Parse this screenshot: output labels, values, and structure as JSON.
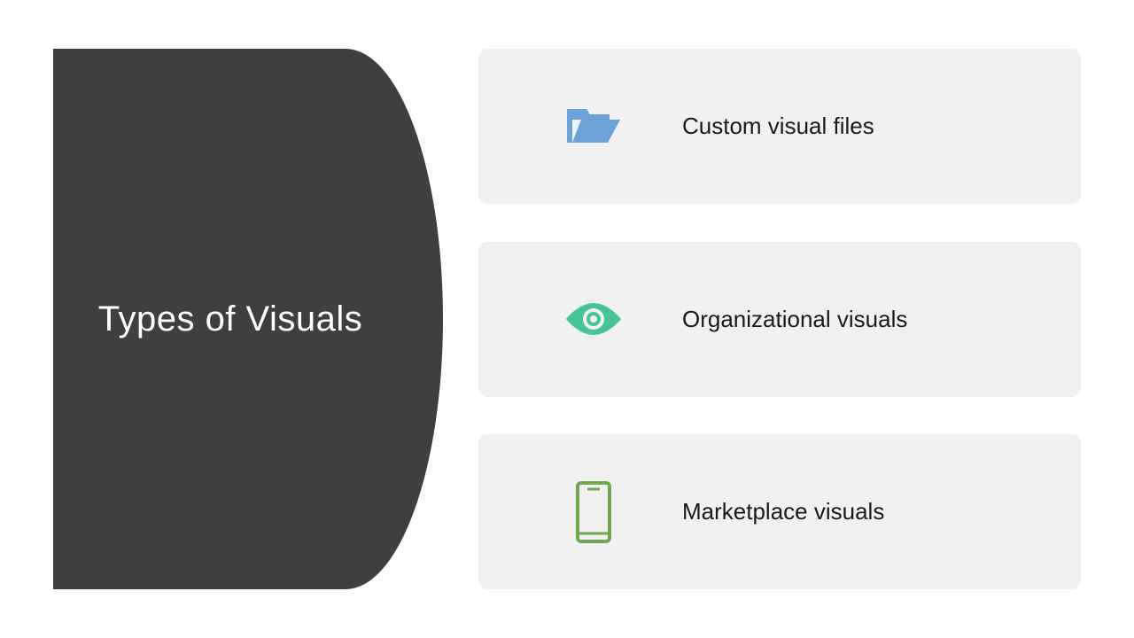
{
  "sidebar": {
    "title": "Types of Visuals"
  },
  "cards": [
    {
      "icon": "folder-open-icon",
      "color": "#6ba3d9",
      "label": "Custom visual files"
    },
    {
      "icon": "eye-icon",
      "color": "#47c494",
      "label": "Organizational visuals"
    },
    {
      "icon": "smartphone-icon",
      "color": "#6fa84f",
      "label": "Marketplace visuals"
    }
  ]
}
